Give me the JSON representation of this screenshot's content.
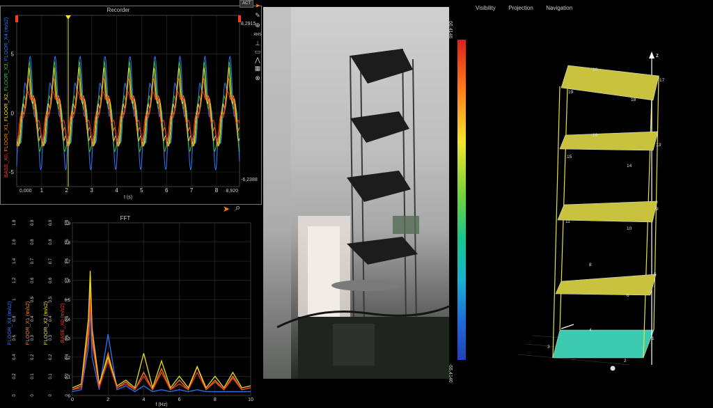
{
  "recorder": {
    "title": "Recorder",
    "act_badge": "ACT",
    "ymax": "8,2915",
    "ymin": "-6,2388",
    "xstart": "0,000",
    "xend": "8,920",
    "xlabel": "t (s)",
    "xticks": [
      "1",
      "2",
      "3",
      "4",
      "5",
      "6",
      "7",
      "8"
    ],
    "yticks": [
      "5",
      "0",
      "-5"
    ],
    "ylabel_channels": [
      {
        "name": "BASE_X0",
        "color": "#ff3b1f"
      },
      {
        "name": "FLOOR_X1",
        "color": "#ff8c1a"
      },
      {
        "name": "FLOOR_X2",
        "color": "#f5e52a"
      },
      {
        "name": "FLOOR_X3",
        "color": "#3cc84a"
      },
      {
        "name": "FLOOR_X4 (m/s2)",
        "color": "#2f7cff"
      }
    ],
    "cursor_icon": "pointer-cursor-icon",
    "zoom_icon": "magnifier-icon"
  },
  "toolbar": {
    "items": [
      "arrow-icon",
      "pencil-icon",
      "crosshair-icon",
      "RMS",
      "marker-icon",
      "minus-icon",
      "peak-icon",
      "grid-icon",
      "close-circle-icon"
    ]
  },
  "fft": {
    "title": "FFT",
    "xlabel": "f (Hz)",
    "xticks": [
      "0",
      "2",
      "4",
      "6",
      "8",
      "10"
    ],
    "axes": [
      {
        "label": "FLOOR_X4 (m/s2)",
        "color": "#2f7cff",
        "ticks": [
          "0",
          "0.2",
          "0.4",
          "0.6",
          "0.8",
          "1",
          "1.2",
          "1.4",
          "1.6",
          "1.8"
        ]
      },
      {
        "label": "FLOOR_X1 (m/s2)",
        "color": "#ff8c1a",
        "ticks": [
          "0",
          "0.1",
          "0.2",
          "0.3",
          "0.4",
          "0.5",
          "0.6",
          "0.7",
          "0.8",
          "0.9"
        ]
      },
      {
        "label": "FLOOR_X2 (m/s2)",
        "color": "#f5e52a",
        "ticks": [
          "0",
          "0.1",
          "0.2",
          "0.3",
          "0.4",
          "0.5",
          "0.6",
          "0.7",
          "0.8",
          "0.9"
        ]
      },
      {
        "label": "BASE_X0 (m/s2)",
        "color": "#ff3b1f",
        "ticks": [
          "0",
          "0.2",
          "0.4",
          "0.6",
          "0.8",
          "1",
          "1.2",
          "1.4",
          "1.6",
          "1.8"
        ]
      }
    ],
    "main_ticks": [
      "0",
      "0.1",
      "0.2",
      "0.3",
      "0.4",
      "0.5",
      "0.6",
      "0.7",
      "0.8",
      "0.9"
    ]
  },
  "colorbar": {
    "top": "66,4146",
    "bottom": "-66,4146"
  },
  "model3d": {
    "menu": [
      "Visibility",
      "Projection",
      "Navigation"
    ],
    "axis_label": "z",
    "node_labels": [
      "1",
      "2",
      "3",
      "4",
      "5",
      "6",
      "8",
      "9",
      "10",
      "11",
      "13",
      "14",
      "15",
      "16",
      "17",
      "18",
      "19",
      "20"
    ]
  },
  "chart_data": {
    "type": "line",
    "title": "FFT",
    "xlabel": "f (Hz)",
    "ylabel": "",
    "xlim": [
      0,
      10
    ],
    "ylim": [
      0,
      0.9
    ],
    "x": [
      0,
      0.5,
      0.9,
      1.0,
      1.1,
      1.5,
      2.0,
      2.5,
      3.0,
      3.5,
      4.0,
      4.5,
      5.0,
      5.5,
      6.0,
      6.5,
      7.0,
      7.5,
      8.0,
      8.5,
      9.0,
      9.5,
      10.0
    ],
    "series": [
      {
        "name": "FLOOR_X4 (m/s2)",
        "color": "#2f7cff",
        "values": [
          0.02,
          0.03,
          0.25,
          0.45,
          0.2,
          0.03,
          0.32,
          0.03,
          0.05,
          0.02,
          0.05,
          0.02,
          0.03,
          0.02,
          0.03,
          0.02,
          0.03,
          0.02,
          0.02,
          0.02,
          0.02,
          0.02,
          0.02
        ]
      },
      {
        "name": "FLOOR_X1 (m/s2)",
        "color": "#ff8c1a",
        "values": [
          0.03,
          0.05,
          0.35,
          0.58,
          0.3,
          0.05,
          0.22,
          0.04,
          0.07,
          0.03,
          0.12,
          0.03,
          0.14,
          0.03,
          0.08,
          0.03,
          0.15,
          0.03,
          0.08,
          0.03,
          0.1,
          0.03,
          0.04
        ]
      },
      {
        "name": "FLOOR_X2 (m/s2)",
        "color": "#f5e52a",
        "values": [
          0.04,
          0.06,
          0.4,
          0.65,
          0.35,
          0.06,
          0.2,
          0.05,
          0.08,
          0.04,
          0.22,
          0.04,
          0.18,
          0.04,
          0.1,
          0.04,
          0.15,
          0.04,
          0.1,
          0.04,
          0.12,
          0.04,
          0.05
        ]
      },
      {
        "name": "BASE_X0 (m/s2)",
        "color": "#ff3b1f",
        "values": [
          0.03,
          0.04,
          0.3,
          0.5,
          0.28,
          0.04,
          0.18,
          0.04,
          0.06,
          0.03,
          0.1,
          0.03,
          0.12,
          0.03,
          0.06,
          0.03,
          0.12,
          0.03,
          0.07,
          0.03,
          0.09,
          0.03,
          0.04
        ]
      }
    ]
  }
}
